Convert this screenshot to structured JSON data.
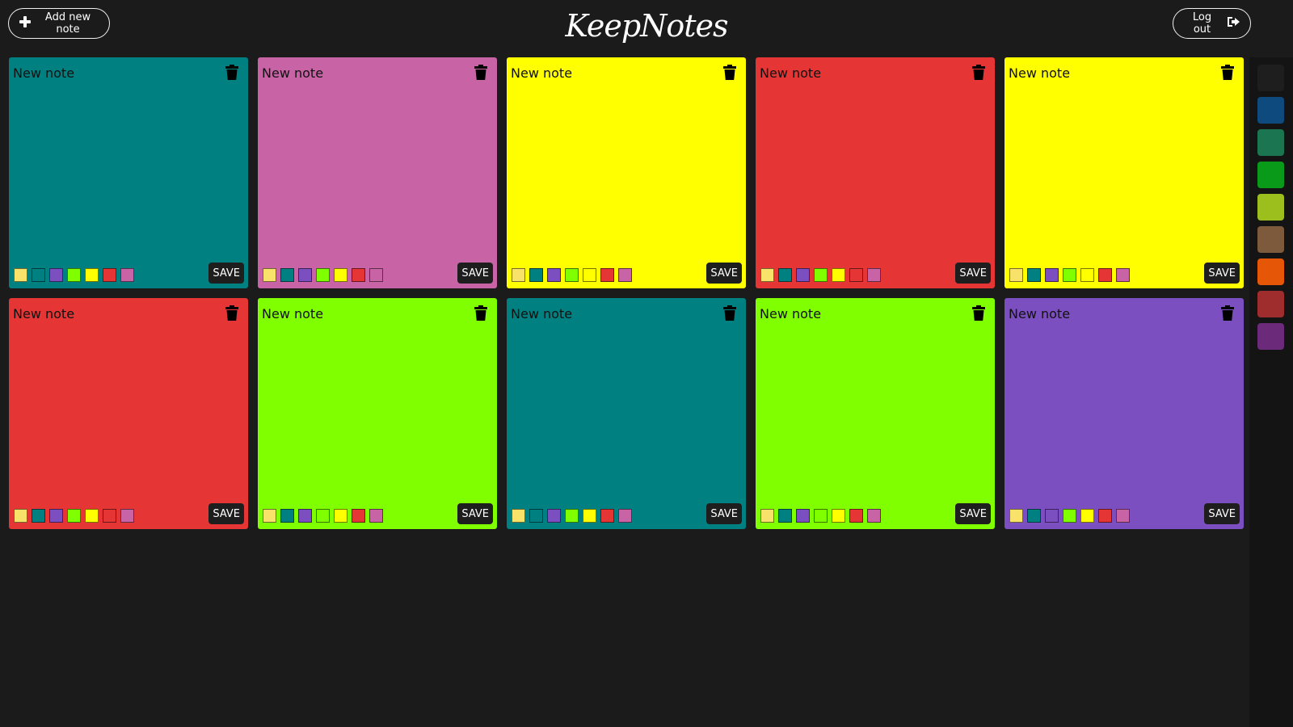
{
  "header": {
    "add_label": "Add new note",
    "logo": "KeepNotes",
    "logout_label": "Log out"
  },
  "note_palette": [
    "#f8e26a",
    "#008080",
    "#7b4fc0",
    "#7fff00",
    "#ffff00",
    "#e53535",
    "#c864a6"
  ],
  "notes": [
    {
      "title": "New note",
      "color": "#008080",
      "save_label": "SAVE"
    },
    {
      "title": "New note",
      "color": "#c864a6",
      "save_label": "SAVE"
    },
    {
      "title": "New note",
      "color": "#ffff00",
      "save_label": "SAVE"
    },
    {
      "title": "New note",
      "color": "#e53535",
      "save_label": "SAVE"
    },
    {
      "title": "New note",
      "color": "#ffff00",
      "save_label": "SAVE"
    },
    {
      "title": "New note",
      "color": "#e53535",
      "save_label": "SAVE"
    },
    {
      "title": "New note",
      "color": "#7fff00",
      "save_label": "SAVE"
    },
    {
      "title": "New note",
      "color": "#008080",
      "save_label": "SAVE"
    },
    {
      "title": "New note",
      "color": "#7fff00",
      "save_label": "SAVE"
    },
    {
      "title": "New note",
      "color": "#7b4fc0",
      "save_label": "SAVE"
    }
  ],
  "theme_palette": [
    "#1e1e1e",
    "#0e4a7e",
    "#1a7550",
    "#0a9a1a",
    "#9cbf1e",
    "#7d5a3c",
    "#e55606",
    "#a02d2d",
    "#6c2a7a"
  ]
}
